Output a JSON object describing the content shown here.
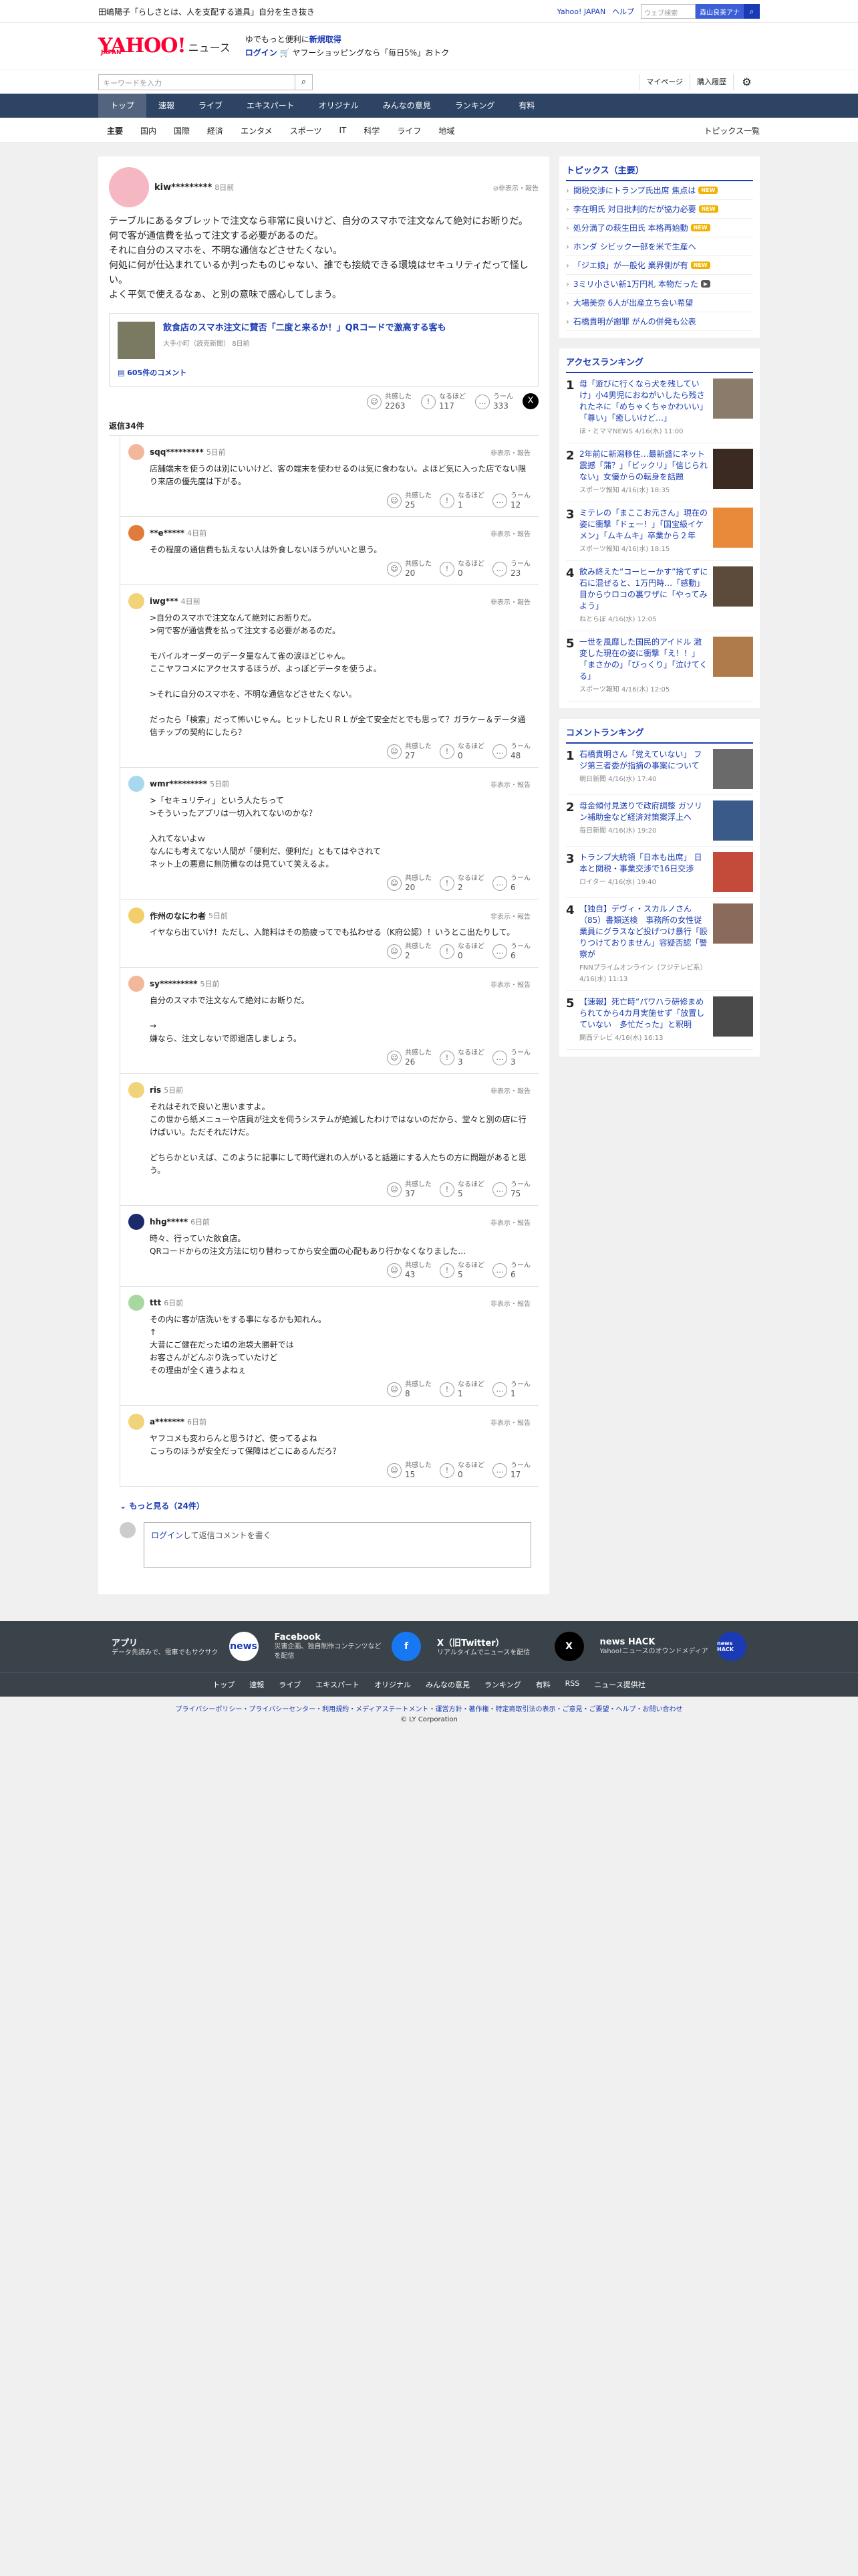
{
  "topstrip": {
    "news": "田嶋陽子「らしさとは、人を支配する道具」自分を生き抜き",
    "yahoo_japan": "Yahoo! JAPAN",
    "help": "ヘルプ",
    "search_placeholder": "ウェブ検索",
    "search_chip": "森山良美アナ"
  },
  "header": {
    "logo_main": "YAHOO!",
    "logo_sub": "ニュース",
    "logo_jp": "JAPAN",
    "promo_line1_a": "ゆでもっと便利に",
    "promo_line1_b": "新規取得",
    "promo_login": "ログイン",
    "promo_line2": "ヤフーショッピングなら「毎日5%」おトク"
  },
  "search": {
    "placeholder": "キーワードを入力",
    "mypage": "マイページ",
    "history": "購入履歴"
  },
  "nav": [
    "トップ",
    "速報",
    "ライブ",
    "エキスパート",
    "オリジナル",
    "みんなの意見",
    "ランキング",
    "有料"
  ],
  "subnav": [
    "主要",
    "国内",
    "国際",
    "経済",
    "エンタメ",
    "スポーツ",
    "IT",
    "科学",
    "ライフ",
    "地域"
  ],
  "subnav_end": "トピックス一覧",
  "main_comment": {
    "user": "kiw*********",
    "time": "8日前",
    "report": "非表示・報告",
    "body": "テーブルにあるタブレットで注文なら非常に良いけど、自分のスマホで注文なんて絶対にお断りだ。\n何で客が通信費を払って注文する必要があるのだ。\nそれに自分のスマホを、不明な通信などさせたくない。\n何処に何が仕込まれているか判ったものじゃない、誰でも接続できる環境はセキュリティだって怪しい。\nよく平気で使えるなぁ、と別の意味で感心してしまう。",
    "article": {
      "title": "飲食店のスマホ注文に賛否「二度と来るか！」QRコードで激高する客も",
      "source": "大手小町（読売新聞）",
      "time": "8日前",
      "comments": "605件のコメント"
    },
    "reactions": {
      "agree_label": "共感した",
      "agree": "2263",
      "insight_label": "なるほど",
      "insight": "117",
      "hmm_label": "うーん",
      "hmm": "333"
    },
    "x_label": "X"
  },
  "replies_label": "返信34件",
  "replies": [
    {
      "user": "sqq*********",
      "time": "5日前",
      "body": "店舗端末を使うのは別にいいけど、客の端末を使わせるのは気に食わない。よほど気に入った店でない限り来店の優先度は下がる。",
      "agree": "25",
      "insight": "1",
      "hmm": "12",
      "color": "#f3b79c"
    },
    {
      "user": "**e*****",
      "time": "4日前",
      "body": "その程度の通信費も払えない人は外食しないほうがいいと思う。",
      "agree": "20",
      "insight": "0",
      "hmm": "23",
      "color": "#e07b39"
    },
    {
      "user": "iwg***",
      "time": "4日前",
      "body": ">自分のスマホで注文なんて絶対にお断りだ。\n>何で客が通信費を払って注文する必要があるのだ。\n\nモバイルオーダーのデータ量なんて雀の涙ほどじゃん。\nここヤフコメにアクセスするほうが、よっぽどデータを使うよ。\n\n>それに自分のスマホを、不明な通信などさせたくない。\n\nだったら「検索」だって怖いじゃん。ヒットしたＵＲＬが全て安全だとでも思って？ガラケー＆データ通信チップの契約にしたら？",
      "agree": "27",
      "insight": "0",
      "hmm": "48",
      "color": "#f1d37a"
    },
    {
      "user": "wmr*********",
      "time": "5日前",
      "body": ">「セキュリティ」という人たちって\n>そういったアプリは一切入れてないのかな？\n\n入れてないよｗ\nなんにも考えてない人間が「便利だ、便利だ」ともてはやされて\nネット上の悪意に無防備なのは見ていて笑えるよ。",
      "agree": "20",
      "insight": "2",
      "hmm": "6",
      "color": "#a7d8ee"
    },
    {
      "user": "作州のなにわ者",
      "time": "5日前",
      "body": "イヤなら出ていけ！ただし、入館料はその筋疲ってでも払わせる（K府公認）！いうとこ出たりして。",
      "agree": "2",
      "insight": "0",
      "hmm": "6",
      "color": "#f2cf6b"
    },
    {
      "user": "sy*********",
      "time": "5日前",
      "body": "自分のスマホで注文なんて絶対にお断りだ。\n\n→\n嫌なら、注文しないで即退店しましょう。",
      "agree": "26",
      "insight": "3",
      "hmm": "3",
      "color": "#f3b79c"
    },
    {
      "user": "ris",
      "time": "5日前",
      "body": "それはそれで良いと思いますよ。\nこの世から紙メニューや店員が注文を伺うシステムが絶滅したわけではないのだから、堂々と別の店に行けばいい。ただそれだけだ。\n\nどちらかといえば、このように記事にして時代遅れの人がいると話題にする人たちの方に問題があると思う。",
      "agree": "37",
      "insight": "5",
      "hmm": "75",
      "color": "#f1d37a"
    },
    {
      "user": "hhg*****",
      "time": "6日前",
      "body": "時々、行っていた飲食店。\nQRコードからの注文方法に切り替わってから安全面の心配もあり行かなくなりました…",
      "agree": "43",
      "insight": "5",
      "hmm": "6",
      "color": "#1b2a6b"
    },
    {
      "user": "ttt",
      "time": "6日前",
      "body": "その内に客が店洗いをする事になるかも知れん。\n↑\n大昔にご健在だった頃の池袋大勝軒では\nお客さんがどんぶり洗っていたけど\nその理由が全く違うよねぇ",
      "agree": "8",
      "insight": "1",
      "hmm": "1",
      "color": "#a8d8a0"
    },
    {
      "user": "a*******",
      "time": "6日前",
      "body": "ヤフコメも変わらんと思うけど、使ってるよね\nこっちのほうが安全だって保障はどこにあるんだろ？",
      "agree": "15",
      "insight": "0",
      "hmm": "17",
      "color": "#f1d37a"
    }
  ],
  "more_replies": "もっと見る（24件）",
  "login_prompt_link": "ログイン",
  "login_prompt_text": "して返信コメントを書く",
  "sidebar": {
    "topics_title": "トピックス（主要）",
    "topics": [
      {
        "text": "関税交渉にトランプ氏出席 焦点は",
        "badge": "NEW"
      },
      {
        "text": "李在明氏 対日批判的だが協力必要",
        "badge": "NEW"
      },
      {
        "text": "処分満了の萩生田氏 本格再始動",
        "badge": "NEW"
      },
      {
        "text": "ホンダ シビック一部を米で生産へ",
        "badge": ""
      },
      {
        "text": "「ジエ娘」が一般化 業界側が有",
        "badge": "NEW"
      },
      {
        "text": "3ミリ小さい新1万円札 本物だった",
        "badge": "CAM"
      },
      {
        "text": "大場美奈 6人が出産立ち会い希望",
        "badge": ""
      },
      {
        "text": "石橋貴明が謝罪 がんの併発も公表",
        "badge": ""
      }
    ],
    "access_title": "アクセスランキング",
    "access": [
      {
        "num": "1",
        "text": "母「遊びに行くなら犬を残していけ」小4男児におねがいしたら残されたネに「めちゃくちゃかわいい」「尊い」「癒しいけど…」",
        "meta": "ほ・とママNEWS 4/16(水) 11:00",
        "color": "#8a7b6a"
      },
      {
        "num": "2",
        "text": "2年前に新潟移住…最新盛にネット震撼「蒲？」「ビックリ」「信じられない」女優からの転身を話題",
        "meta": "スポーツ報知 4/16(水) 18:35",
        "color": "#3a2a22"
      },
      {
        "num": "3",
        "text": "ミテレの「まここお元さん」現在の姿に衝撃「ドェー！」「国宝級イケメン」「ムキムキ」卒業から２年",
        "meta": "スポーツ報知 4/16(水) 18:15",
        "color": "#e98a3a"
      },
      {
        "num": "4",
        "text": "飲み終えた“コーヒーかす”捨てずに石に混ぜると、1万円時…「感動」目からウロコの裏ワザに「やってみよう」",
        "meta": "ねとらぼ 4/16(水) 12:05",
        "color": "#5c4a3a"
      },
      {
        "num": "5",
        "text": "一世を風靡した国民的アイドル 激変した現在の姿に衝撃「え！！」「まさかの」「びっくり」「泣けてくる」",
        "meta": "スポーツ報知 4/16(水) 12:05",
        "color": "#b07b4a"
      }
    ],
    "comment_title": "コメントランキング",
    "comment_rank": [
      {
        "num": "1",
        "text": "石橋貴明さん「覚えていない」 フジ第三者委が指摘の事案について",
        "meta": "朝日新聞 4/16(水) 17:40",
        "color": "#6a6a6a"
      },
      {
        "num": "2",
        "text": "母金傾付見送りで政府調整 ガソリン補助金など経済対策案浮上へ",
        "meta": "毎日新聞 4/16(水) 19:20",
        "color": "#3a5a8a"
      },
      {
        "num": "3",
        "text": "トランプ大統領「日本も出席」 日本と関税・事業交渉で16日交渉",
        "meta": "ロイター 4/16(水) 19:40",
        "color": "#c44a3a"
      },
      {
        "num": "4",
        "text": "【独自】デヴィ・スカルノさん（85）書類送検　事務所の女性従業員にグラスなど投げつけ暴行「殴りつけておりません」容疑否認「警察が",
        "meta": "FNNプライムオンライン（フジテレビ系） 4/16(水) 11:13",
        "color": "#8a6a5a"
      },
      {
        "num": "5",
        "text": "【速報】死亡時“パワハラ研修まめられてから4カ月実施せず「放置していない　多忙だった」と釈明",
        "meta": "関西テレビ 4/16(水) 16:13",
        "color": "#4a4a4a"
      }
    ]
  },
  "footer": {
    "apps": [
      {
        "title": "アプリ",
        "desc": "データ先読みで、電車でもサクサク",
        "icon": "news"
      },
      {
        "title": "Facebook",
        "desc": "災害企画、独自制作コンテンツなどを配信",
        "icon": "f"
      },
      {
        "title": "X（旧Twitter）",
        "desc": "リアルタイムでニュースを配信",
        "icon": "X"
      },
      {
        "title": "news HACK",
        "desc": "Yahoo!ニュースのオウンドメディア",
        "icon": "news HACK"
      }
    ],
    "links": [
      "トップ",
      "速報",
      "ライブ",
      "エキスパート",
      "オリジナル",
      "みんなの意見",
      "ランキング",
      "有料",
      "RSS",
      "ニュース提供社"
    ],
    "legal": "プライバシーポリシー・プライバシーセンター・利用規約・メディアステートメント・運営方針・著作権・特定商取引法の表示・ご意見・ご要望・ヘルプ・お問い合わせ",
    "copyright": "© LY Corporation"
  },
  "colors": {
    "brand": "#ff0033",
    "link": "#1a3bb3",
    "nav": "#2d4465"
  }
}
